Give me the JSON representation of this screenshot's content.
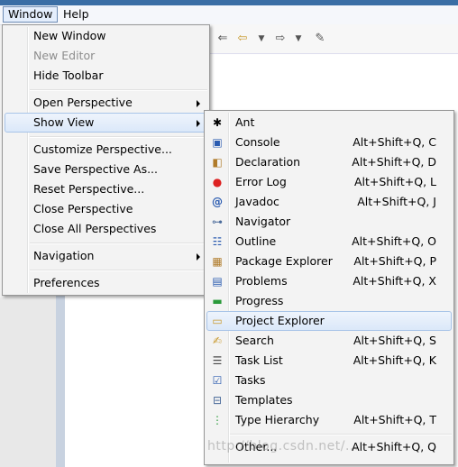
{
  "menubar": {
    "window": "Window",
    "help": "Help"
  },
  "window_menu": {
    "items": [
      {
        "label": "New Window"
      },
      {
        "label": "New Editor"
      },
      {
        "label": "Hide Toolbar"
      },
      {
        "label": "Open Perspective"
      },
      {
        "label": "Show View"
      },
      {
        "label": "Customize Perspective..."
      },
      {
        "label": "Save Perspective As..."
      },
      {
        "label": "Reset Perspective..."
      },
      {
        "label": "Close Perspective"
      },
      {
        "label": "Close All Perspectives"
      },
      {
        "label": "Navigation"
      },
      {
        "label": "Preferences"
      }
    ]
  },
  "show_view": {
    "items": [
      {
        "label": "Ant",
        "shortcut": "",
        "icon": "ant-icon"
      },
      {
        "label": "Console",
        "shortcut": "Alt+Shift+Q, C",
        "icon": "console-icon"
      },
      {
        "label": "Declaration",
        "shortcut": "Alt+Shift+Q, D",
        "icon": "declaration-icon"
      },
      {
        "label": "Error Log",
        "shortcut": "Alt+Shift+Q, L",
        "icon": "error-log-icon"
      },
      {
        "label": "Javadoc",
        "shortcut": "Alt+Shift+Q, J",
        "icon": "javadoc-icon"
      },
      {
        "label": "Navigator",
        "shortcut": "",
        "icon": "navigator-icon"
      },
      {
        "label": "Outline",
        "shortcut": "Alt+Shift+Q, O",
        "icon": "outline-icon"
      },
      {
        "label": "Package Explorer",
        "shortcut": "Alt+Shift+Q, P",
        "icon": "package-explorer-icon"
      },
      {
        "label": "Problems",
        "shortcut": "Alt+Shift+Q, X",
        "icon": "problems-icon"
      },
      {
        "label": "Progress",
        "shortcut": "",
        "icon": "progress-icon"
      },
      {
        "label": "Project Explorer",
        "shortcut": "",
        "icon": "folder-icon"
      },
      {
        "label": "Search",
        "shortcut": "Alt+Shift+Q, S",
        "icon": "search-icon"
      },
      {
        "label": "Task List",
        "shortcut": "Alt+Shift+Q, K",
        "icon": "task-list-icon"
      },
      {
        "label": "Tasks",
        "shortcut": "",
        "icon": "tasks-icon"
      },
      {
        "label": "Templates",
        "shortcut": "",
        "icon": "templates-icon"
      },
      {
        "label": "Type Hierarchy",
        "shortcut": "Alt+Shift+Q, T",
        "icon": "type-hierarchy-icon"
      },
      {
        "label": "Other...",
        "shortcut": "Alt+Shift+Q, Q",
        "icon": "other-views-icon"
      }
    ]
  },
  "watermark": "http://blog.csdn.net/..."
}
